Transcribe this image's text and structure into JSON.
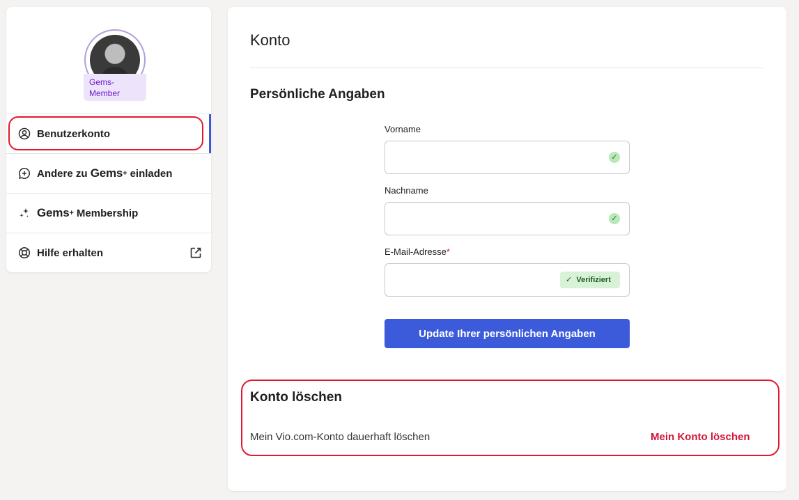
{
  "sidebar": {
    "badge": {
      "line1": "Gems-",
      "line2": "Member"
    },
    "items": [
      {
        "label": "Benutzerkonto",
        "icon": "user-circle-icon",
        "active": true
      },
      {
        "label_before": "Andere zu",
        "brand": "Gems",
        "brand_sup": "+",
        "label_after": "einladen",
        "icon": "chat-plus-icon"
      },
      {
        "brand": "Gems",
        "brand_sup": "+",
        "label_after": "Membership",
        "icon": "sparkles-icon"
      },
      {
        "label": "Hilfe erhalten",
        "icon": "lifebuoy-icon",
        "trailing_icon": "external-link-icon"
      }
    ]
  },
  "main": {
    "title": "Konto",
    "personal": {
      "title": "Persönliche Angaben",
      "first_name_label": "Vorname",
      "first_name_value": "",
      "last_name_label": "Nachname",
      "last_name_value": "",
      "email_label": "E-Mail-Adresse",
      "email_required_marker": "*",
      "email_value": "",
      "verified_badge": "Verifiziert",
      "update_button": "Update Ihrer persönlichen Angaben"
    },
    "delete": {
      "title": "Konto löschen",
      "description": "Mein Vio.com-Konto dauerhaft löschen",
      "link": "Mein Konto löschen"
    }
  },
  "colors": {
    "accent": "#3b5bdb",
    "danger": "#d1173a",
    "badge_bg": "#ede4fb",
    "badge_text": "#6a1bc9",
    "success_bg": "#d8f2d8",
    "highlight_outline": "#e0192f"
  }
}
